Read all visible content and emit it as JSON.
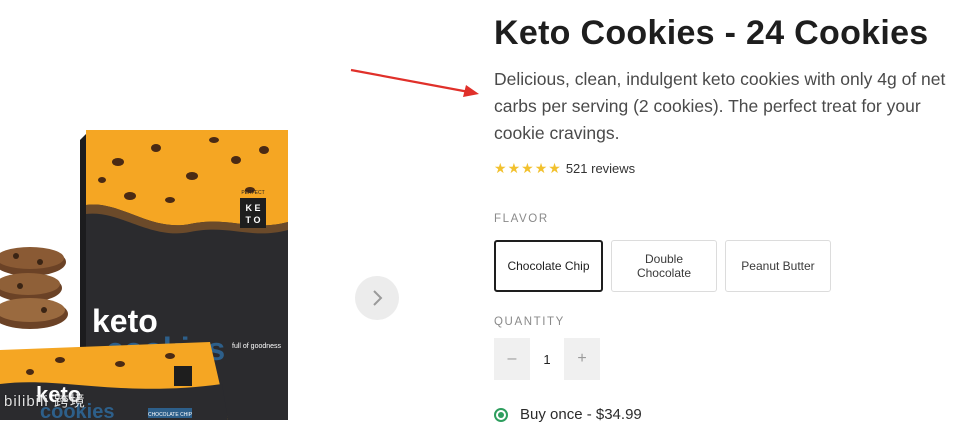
{
  "product": {
    "title": "Keto Cookies - 24 Cookies",
    "description": "Delicious, clean, indulgent keto cookies with only 4g of net carbs per serving (2 cookies). The perfect treat for your cookie cravings.",
    "rating_stars": 5,
    "reviews": "521 reviews"
  },
  "packaging": {
    "brand_small": "PERFECT",
    "box_word1": "keto",
    "box_word2": "cookies",
    "box_tagline": "full of goodness",
    "badge_letters": "K E T O",
    "pouch_label": "CHOCOLATE CHIP"
  },
  "flavor": {
    "label": "FLAVOR",
    "options": [
      {
        "label": "Chocolate Chip",
        "selected": true
      },
      {
        "label": "Double Chocolate",
        "selected": false
      },
      {
        "label": "Peanut Butter",
        "selected": false
      }
    ]
  },
  "quantity": {
    "label": "QUANTITY",
    "value": "1",
    "minus": "–",
    "plus": "+"
  },
  "purchase": {
    "option_text": "Buy once - $34.99"
  },
  "watermark": "bilibili 跨境",
  "colors": {
    "box_yellow": "#f5a623",
    "box_dark": "#2b2b2e",
    "accent_blue": "#2d5f8a",
    "arrow_red": "#e0302a",
    "star": "#f2c12e",
    "radio_green": "#2e9e5e"
  },
  "icons": {
    "next": "chevron-right-icon",
    "star": "star-icon"
  }
}
